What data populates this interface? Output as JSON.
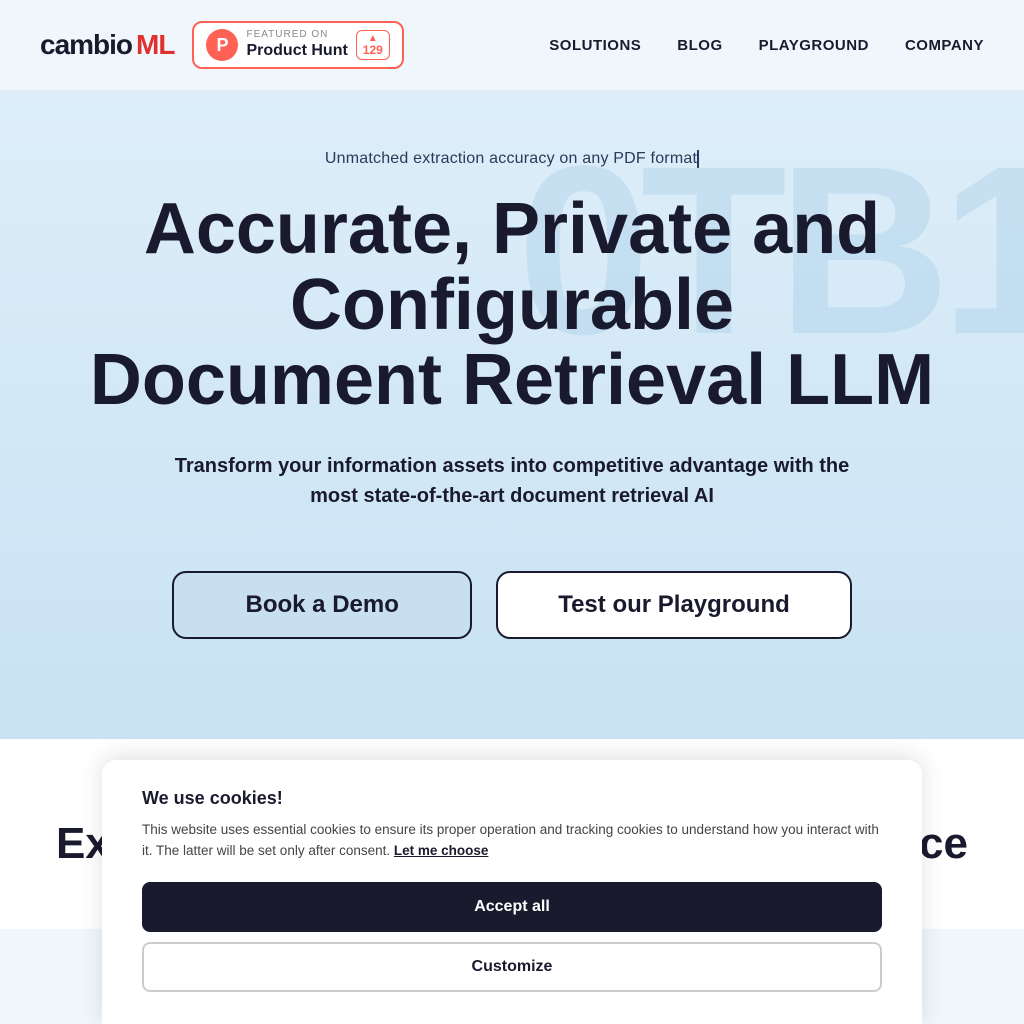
{
  "nav": {
    "logo_cambio": "cambio",
    "logo_ml": "ML",
    "product_hunt": {
      "featured_label": "FEATURED ON",
      "name": "Product Hunt",
      "arrow": "▲",
      "count": "129"
    },
    "links": [
      {
        "label": "SOLUTIONS",
        "id": "solutions"
      },
      {
        "label": "BLOG",
        "id": "blog"
      },
      {
        "label": "PLAYGROUND",
        "id": "playground"
      },
      {
        "label": "COMPANY",
        "id": "company"
      }
    ]
  },
  "hero": {
    "subtitle": "Unmatched extraction accuracy on any PDF format",
    "title_line1": "Accurate, Private and Configurable",
    "title_line2": "Document Retrieval LLM",
    "description": "Transform your information assets into competitive advantage with the most state-of-the-art document retrieval AI",
    "watermark": "0TB1",
    "btn_demo": "Book a Demo",
    "btn_playground": "Test our Playground"
  },
  "section": {
    "title": "Extract key information with full confidence"
  },
  "cookie": {
    "title": "We use cookies!",
    "description": "This website uses essential cookies to ensure its proper operation and tracking cookies to understand how you interact with it. The latter will be set only after consent.",
    "link_text": "Let me choose",
    "btn_accept": "Accept all",
    "btn_customize": "Customize"
  }
}
